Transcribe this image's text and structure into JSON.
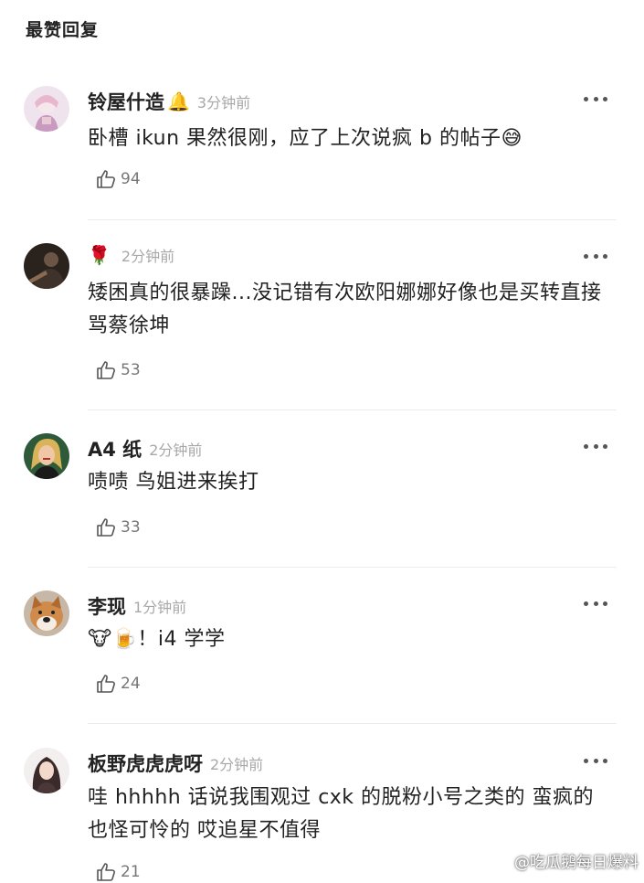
{
  "section": {
    "title": "最赞回复"
  },
  "comments": [
    {
      "user": "铃屋什造",
      "badge": "🔔",
      "time": "3分钟前",
      "text": "卧槽 ikun 果然很刚，应了上次说疯 b 的帖子😅",
      "likes": "94"
    },
    {
      "user": "",
      "badge": "🌹",
      "time": "2分钟前",
      "text": "矮困真的很暴躁...没记错有次欧阳娜娜好像也是买转直接骂蔡徐坤",
      "likes": "53"
    },
    {
      "user": "A4 纸",
      "badge": "",
      "time": "2分钟前",
      "text": "啧啧 鸟姐进来挨打",
      "likes": "33"
    },
    {
      "user": "李现",
      "badge": "",
      "time": "1分钟前",
      "text": "🐮🍺！i4 学学",
      "likes": "24"
    },
    {
      "user": "板野虎虎虎呀",
      "badge": "",
      "time": "2分钟前",
      "text": "哇 hhhhh 话说我围观过 cxk 的脱粉小号之类的 蛮疯的 也怪可怜的 哎追星不值得",
      "likes": "21"
    }
  ],
  "watermark": {
    "text": "@吃瓜鹅每日爆料"
  },
  "icons": {
    "like": "thumbs-up-outline-icon",
    "more": "more-dots-icon",
    "watermark": "weibo-logo-icon"
  },
  "colors": {
    "text": "#222222",
    "muted": "#a8a8a8",
    "like_count": "#777777",
    "divider": "#ececec"
  }
}
